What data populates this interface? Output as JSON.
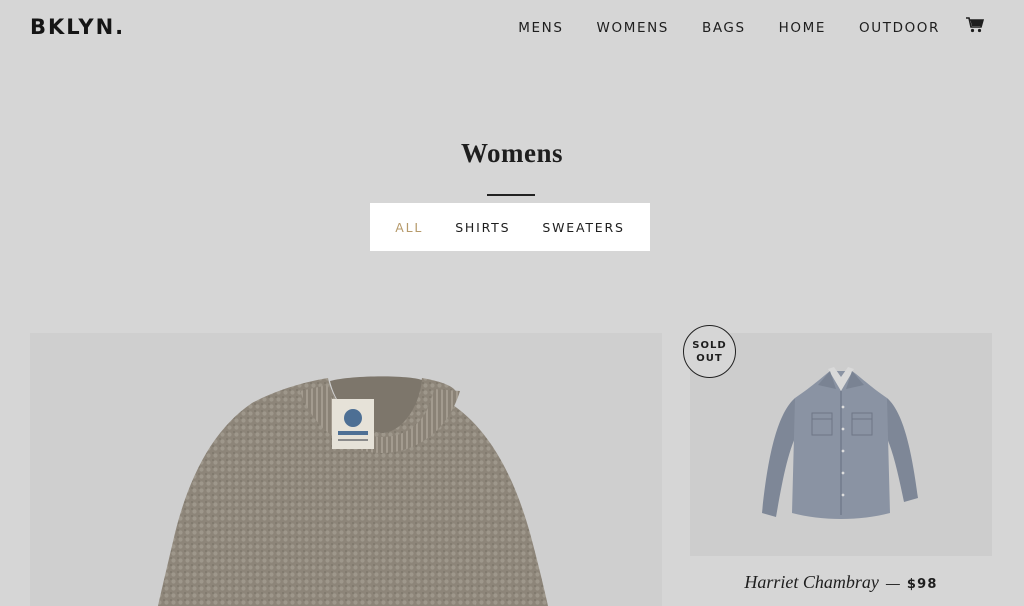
{
  "header": {
    "logo": "BKLYN.",
    "nav": [
      "MENS",
      "WOMENS",
      "BAGS",
      "HOME",
      "OUTDOOR"
    ],
    "cart_icon": "cart-icon"
  },
  "collection": {
    "title": "Womens",
    "filters": [
      "ALL",
      "SHIRTS",
      "SWEATERS"
    ],
    "active_filter": "ALL",
    "active_color": "#b69a6b"
  },
  "products": [
    {
      "image": "knit-sweater-image"
    },
    {
      "image": "chambray-shirt-image",
      "badge": [
        "SOLD",
        "OUT"
      ],
      "name": "Harriet Chambray",
      "separator": "—",
      "price": "$98"
    }
  ],
  "colors": {
    "background": "#d6d6d6",
    "text": "#1e1e1e",
    "filter_bar": "#ffffff"
  }
}
